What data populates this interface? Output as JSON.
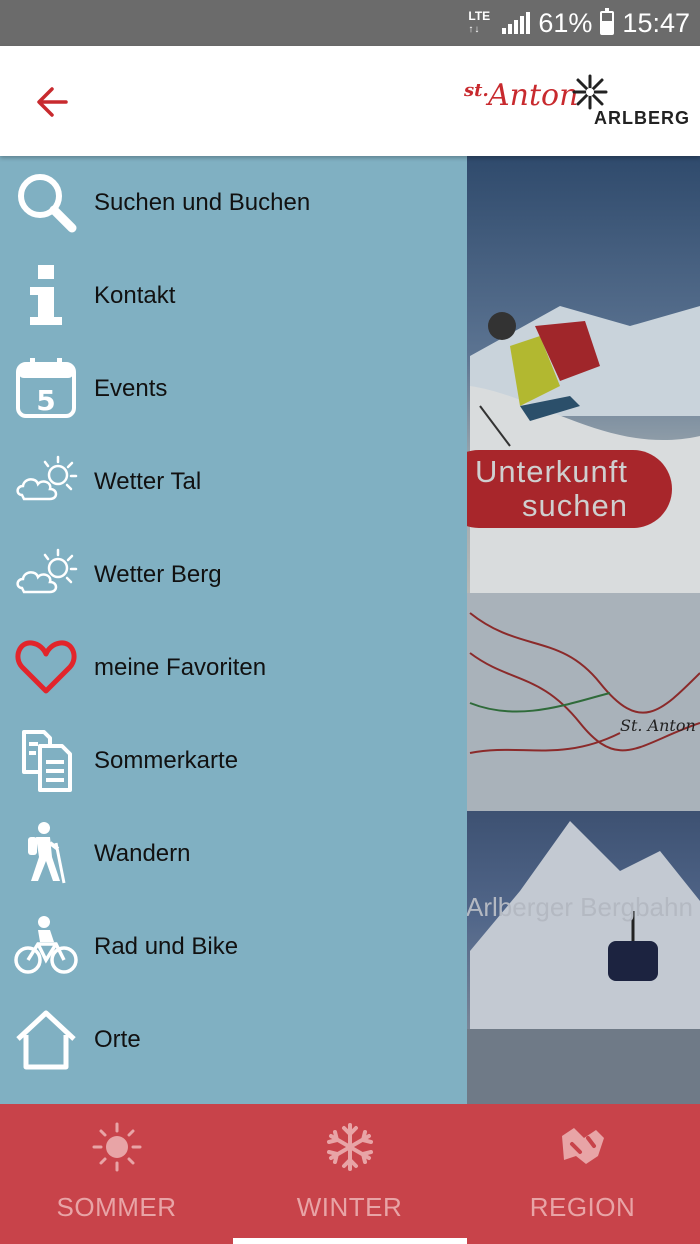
{
  "status_bar": {
    "network": "LTE",
    "battery": "61%",
    "battery_level": 0.61,
    "time": "15:47"
  },
  "header": {
    "back_icon": "arrow-left-icon",
    "logo": {
      "st": "st.",
      "anton": "Anton",
      "region": "ARLBERG"
    }
  },
  "drawer": {
    "items": [
      {
        "label": "Suchen und Buchen",
        "icon": "magnifier-icon"
      },
      {
        "label": "Kontakt",
        "icon": "info-icon"
      },
      {
        "label": "Events",
        "icon": "calendar-icon",
        "icon_text": "5"
      },
      {
        "label": "Wetter Tal",
        "icon": "weather-icon"
      },
      {
        "label": "Wetter Berg",
        "icon": "weather-icon"
      },
      {
        "label": "meine Favoriten",
        "icon": "heart-icon"
      },
      {
        "label": "Sommerkarte",
        "icon": "documents-icon"
      },
      {
        "label": "Wandern",
        "icon": "hiker-icon"
      },
      {
        "label": "Rad und Bike",
        "icon": "cyclist-icon"
      },
      {
        "label": "Orte",
        "icon": "home-icon"
      }
    ]
  },
  "background": {
    "cta_label": "Unterkunft suchen",
    "map_label": "St. Anton",
    "card_label": "Arlberger Bergbahn"
  },
  "bottom_nav": {
    "items": [
      {
        "label": "SOMMER",
        "icon": "sun-icon"
      },
      {
        "label": "WINTER",
        "icon": "snowflake-icon"
      },
      {
        "label": "REGION",
        "icon": "map-icon"
      }
    ],
    "active_index": 1
  },
  "colors": {
    "brand_red": "#c82a2e",
    "drawer_bg": "#80b0c2",
    "bottom_nav_bg": "#c8434a",
    "heart_red": "#e2252b"
  }
}
